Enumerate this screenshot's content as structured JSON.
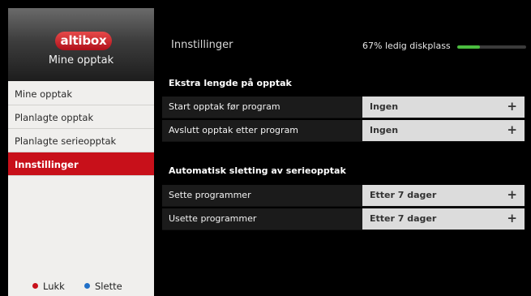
{
  "brand": {
    "logo_text": "altibox",
    "subtitle": "Mine opptak"
  },
  "nav": {
    "items": [
      {
        "label": "Mine opptak"
      },
      {
        "label": "Planlagte opptak"
      },
      {
        "label": "Planlagte serieopptak"
      },
      {
        "label": "Innstillinger",
        "active": true
      }
    ]
  },
  "legend": {
    "close_label": "Lukk",
    "delete_label": "Slette"
  },
  "header": {
    "title": "Innstillinger",
    "disk_text": "67% ledig diskplass",
    "disk_free_percent": 67
  },
  "sections": [
    {
      "heading": "Ekstra lengde på opptak",
      "rows": [
        {
          "label": "Start opptak før program",
          "value": "Ingen"
        },
        {
          "label": "Avslutt opptak etter program",
          "value": "Ingen"
        }
      ]
    },
    {
      "heading": "Automatisk sletting av serieopptak",
      "rows": [
        {
          "label": "Sette programmer",
          "value": "Etter 7 dager"
        },
        {
          "label": "Usette programmer",
          "value": "Etter 7 dager"
        }
      ]
    }
  ],
  "icons": {
    "increase": "plus-icon",
    "close": "red-dot-icon",
    "delete": "blue-dot-icon"
  },
  "colors": {
    "accent_red": "#c8101a",
    "disk_green": "#4bbd3f",
    "legend_blue": "#2170c8"
  }
}
